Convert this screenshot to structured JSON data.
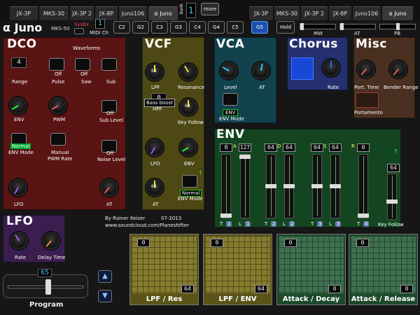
{
  "tabs": [
    "JX-3P",
    "MKS-30",
    "JX-3P 2",
    "JX-8P",
    "Juno106",
    "α Juno",
    "JX-3P",
    "MKS-30",
    "JX-3P 2",
    "JX-8P",
    "Juno106",
    "α Juno"
  ],
  "bank_label": "bank",
  "bank_value": "1",
  "more_label": "more",
  "app_title": "α Juno",
  "device_label": "MKS-50",
  "sysex_label": "SysEx",
  "midi_ch_label": "MIDI Ch",
  "midi_ch_value": "1",
  "notes": [
    "C2",
    "G2",
    "C3",
    "G3",
    "C4",
    "G4",
    "C5",
    "G5"
  ],
  "hold_label": "Hold",
  "mw_label": "MW",
  "at_label": "AT",
  "pb_label": "PB",
  "dco": {
    "title": "DCO",
    "waveforms": "Waveforms",
    "range": "Range",
    "range_val": "4",
    "pulse": "Pulse",
    "pulse_val": "Off",
    "saw": "Saw",
    "saw_val": "Off",
    "sub": "Sub",
    "env": "ENV",
    "pwm": "PWM",
    "sub_level": "Sub Level",
    "sub_level_val": "Off",
    "env_mode": "ENV Mode",
    "env_mode_val": "Normal",
    "pwm_rate": "PWM Rate",
    "pwm_rate_val": "Manual",
    "noise_level": "Noise Level",
    "noise_level_val": "Off",
    "lfo": "LFO",
    "at": "AT"
  },
  "vcf": {
    "title": "VCF",
    "lpf": "LPF",
    "lpf_val": "64",
    "resonance": "Resonance",
    "hpf_val": "0",
    "hpf_btn": "Bass boost",
    "hpf": "HPF",
    "key_follow": "Key Follow",
    "lfo": "LFO",
    "env": "ENV",
    "at": "AT",
    "at_val": "64",
    "env_mode": "ENV Mode",
    "env_mode_val": "Normal"
  },
  "vca": {
    "title": "VCA",
    "level": "Level",
    "at": "AT",
    "env_mode": "ENV Mode",
    "env_mode_val": "ENV"
  },
  "chorus": {
    "title": "Chorus",
    "rate": "Rate"
  },
  "misc": {
    "title": "Misc",
    "port_time": "Port. Time",
    "bender_range": "Bender Range",
    "portamento": "Portamento"
  },
  "env": {
    "title": "ENV",
    "values": [
      "0",
      "127",
      "64",
      "64",
      "64",
      "64",
      "0"
    ],
    "letters": [
      "A",
      "D",
      "S",
      "R"
    ],
    "bottom_labels": [
      "T",
      "L",
      "T",
      "L",
      "T",
      "L",
      "T"
    ],
    "bottom_nums": [
      "1",
      "1",
      "2",
      "2",
      "3",
      "3",
      "4"
    ],
    "key_follow": "Key Follow",
    "key_follow_val": "64"
  },
  "lfo": {
    "title": "LFO",
    "rate": "Rate",
    "delay_time": "Delay Time"
  },
  "credits": {
    "author": "By Rainer Keizer",
    "date": "07-2013",
    "url": "www.soundcloud.com/Planeshifter"
  },
  "program": {
    "label": "Program",
    "value": "65"
  },
  "pads": [
    {
      "label": "LPF / Res",
      "top": "0",
      "bottom": "64"
    },
    {
      "label": "LPF / ENV",
      "top": "0",
      "bottom": "64"
    },
    {
      "label": "Attack / Decay",
      "top": "0",
      "bottom": "0"
    },
    {
      "label": "Attack / Release",
      "top": "0",
      "bottom": "0"
    }
  ]
}
